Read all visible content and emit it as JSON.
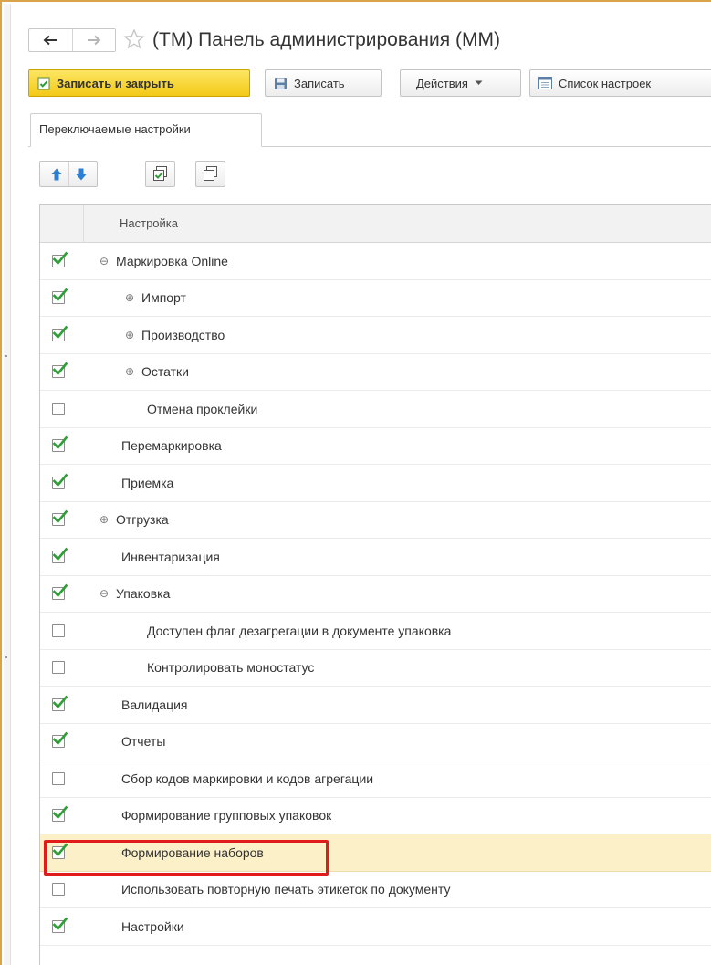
{
  "window": {
    "title": "(ТМ) Панель администрирования (ММ)"
  },
  "toolbar": {
    "save_close_label": "Записать и закрыть",
    "save_label": "Записать",
    "actions_label": "Действия",
    "settings_list_label": "Список настроек"
  },
  "tabs": [
    {
      "label": "Переключаемые настройки",
      "active": true
    }
  ],
  "table": {
    "column_header": "Настройка",
    "rows": [
      {
        "label": "Маркировка Online",
        "checked": true,
        "level": 0,
        "expander": "minus"
      },
      {
        "label": "Импорт",
        "checked": true,
        "level": 1,
        "expander": "plus"
      },
      {
        "label": "Производство",
        "checked": true,
        "level": 1,
        "expander": "plus"
      },
      {
        "label": "Остатки",
        "checked": true,
        "level": 1,
        "expander": "plus"
      },
      {
        "label": "Отмена проклейки",
        "checked": false,
        "level": 1,
        "expander": "none"
      },
      {
        "label": "Перемаркировка",
        "checked": true,
        "level": 0,
        "expander": "none"
      },
      {
        "label": "Приемка",
        "checked": true,
        "level": 0,
        "expander": "none"
      },
      {
        "label": "Отгрузка",
        "checked": true,
        "level": 0,
        "expander": "plus"
      },
      {
        "label": "Инвентаризация",
        "checked": true,
        "level": 0,
        "expander": "none"
      },
      {
        "label": "Упаковка",
        "checked": true,
        "level": 0,
        "expander": "minus"
      },
      {
        "label": "Доступен флаг дезагрегации в документе упаковка",
        "checked": false,
        "level": 1,
        "expander": "none"
      },
      {
        "label": "Контролировать моностатус",
        "checked": false,
        "level": 1,
        "expander": "none"
      },
      {
        "label": "Валидация",
        "checked": true,
        "level": 0,
        "expander": "none"
      },
      {
        "label": "Отчеты",
        "checked": true,
        "level": 0,
        "expander": "none"
      },
      {
        "label": "Сбор кодов маркировки и кодов агрегации",
        "checked": false,
        "level": 0,
        "expander": "none"
      },
      {
        "label": "Формирование групповых упаковок",
        "checked": true,
        "level": 0,
        "expander": "none"
      },
      {
        "label": "Формирование наборов",
        "checked": true,
        "level": 0,
        "expander": "none",
        "selected": true,
        "highlighted": true
      },
      {
        "label": "Использовать повторную печать этикеток по документу",
        "checked": false,
        "level": 0,
        "expander": "none"
      },
      {
        "label": "Настройки",
        "checked": true,
        "level": 0,
        "expander": "none"
      }
    ]
  },
  "colors": {
    "primary_button": "#f6d21f",
    "check_green": "#2e9f36",
    "selected_row": "#fbf0c8",
    "highlight_border": "#e01b1b"
  }
}
